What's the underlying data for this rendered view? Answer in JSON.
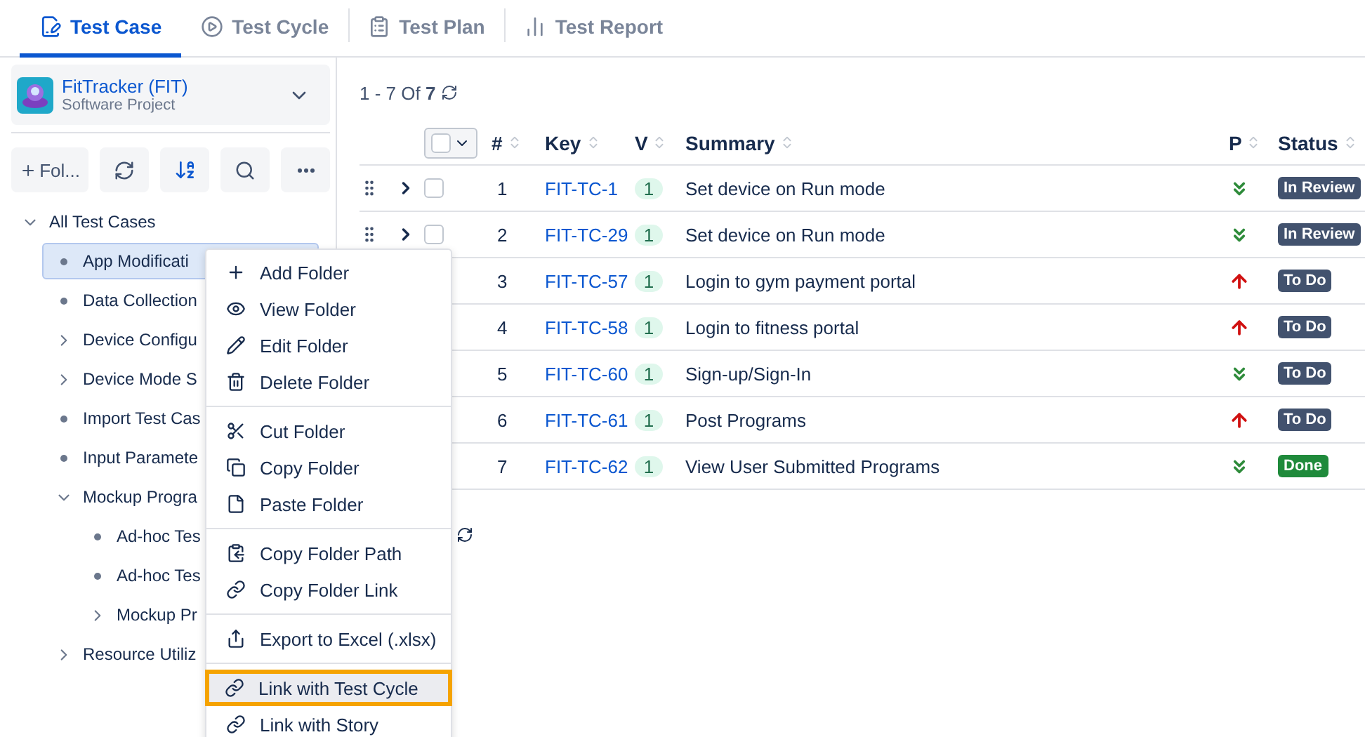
{
  "tabs": [
    {
      "label": "Test Case",
      "kind": "case",
      "selected": true
    },
    {
      "label": "Test Cycle",
      "kind": "cycle",
      "selected": false
    },
    {
      "label": "Test Plan",
      "kind": "plan",
      "selected": false
    },
    {
      "label": "Test Report",
      "kind": "report",
      "selected": false
    }
  ],
  "project": {
    "name": "FitTracker (FIT)",
    "type": "Software Project"
  },
  "folder_toolbar": {
    "add_label": "Fol..."
  },
  "tree": {
    "label": "All Test Cases",
    "expanded": true,
    "children": [
      {
        "label": "App Modificati",
        "kind": "leaf",
        "selected": true
      },
      {
        "label": "Data Collection",
        "kind": "leaf",
        "selected": false
      },
      {
        "label": "Device Configu",
        "kind": "folder",
        "expanded": false,
        "selected": false
      },
      {
        "label": "Device Mode S",
        "kind": "folder",
        "expanded": false,
        "selected": false
      },
      {
        "label": "Import Test Cas",
        "kind": "leaf",
        "selected": false
      },
      {
        "label": "Input Paramete",
        "kind": "leaf",
        "selected": false
      },
      {
        "label": "Mockup Progra",
        "kind": "folder",
        "expanded": true,
        "selected": false,
        "children": [
          {
            "label": "Ad-hoc Tes",
            "kind": "leaf",
            "selected": false
          },
          {
            "label": "Ad-hoc Tes",
            "kind": "leaf",
            "selected": false
          },
          {
            "label": "Mockup Pr",
            "kind": "folder",
            "expanded": false,
            "selected": false
          }
        ]
      },
      {
        "label": "Resource Utiliz",
        "kind": "folder",
        "expanded": false,
        "selected": false
      }
    ]
  },
  "pager": "1 - 7 Of **7**",
  "table": {
    "select_all": {
      "checked": false
    },
    "columns": [
      "#",
      "Key",
      "V",
      "Summary",
      "P",
      "Status"
    ],
    "rows": [
      {
        "num": "1",
        "key": "FIT-TC-1",
        "version": "1",
        "summary": "Set device on Run mode",
        "kind": "lowest",
        "status": "In Review",
        "color": "#42526e",
        "checked": false
      },
      {
        "num": "2",
        "key": "FIT-TC-29",
        "version": "1",
        "summary": "Set device on Run mode",
        "kind": "lowest",
        "status": "In Review",
        "color": "#42526e",
        "checked": false
      },
      {
        "num": "3",
        "key": "FIT-TC-57",
        "version": "1",
        "summary": "Login to gym payment portal",
        "kind": "high",
        "status": "To Do",
        "color": "#42526e"
      },
      {
        "num": "4",
        "key": "FIT-TC-58",
        "version": "1",
        "summary": "Login to fitness portal",
        "kind": "high",
        "status": "To Do",
        "color": "#42526e"
      },
      {
        "num": "5",
        "key": "FIT-TC-60",
        "version": "1",
        "summary": "Sign-up/Sign-In",
        "kind": "lowest",
        "status": "To Do",
        "color": "#42526e"
      },
      {
        "num": "6",
        "key": "FIT-TC-61",
        "version": "1",
        "summary": "Post Programs",
        "kind": "high",
        "status": "To Do",
        "color": "#42526e"
      },
      {
        "num": "7",
        "key": "FIT-TC-62",
        "version": "1",
        "summary": "View User Submitted Programs",
        "kind": "lowest",
        "status": "Done",
        "color": "#1f8a3b"
      }
    ]
  },
  "context_menu": {
    "groups": [
      [
        {
          "label": "Add Folder",
          "selected": false
        },
        {
          "label": "View Folder",
          "selected": false
        },
        {
          "label": "Edit Folder",
          "selected": false
        },
        {
          "label": "Delete Folder",
          "selected": false
        }
      ],
      [
        {
          "label": "Cut Folder",
          "selected": false
        },
        {
          "label": "Copy Folder",
          "selected": false
        },
        {
          "label": "Paste Folder",
          "selected": false
        }
      ],
      [
        {
          "label": "Copy Folder Path",
          "selected": false
        },
        {
          "label": "Copy Folder Link",
          "selected": false
        }
      ],
      [
        {
          "label": "Export to Excel (.xlsx)",
          "selected": false
        }
      ],
      [
        {
          "label": "Link with Test Cycle",
          "selected": true
        },
        {
          "label": "Link with Story",
          "selected": false
        }
      ]
    ]
  }
}
